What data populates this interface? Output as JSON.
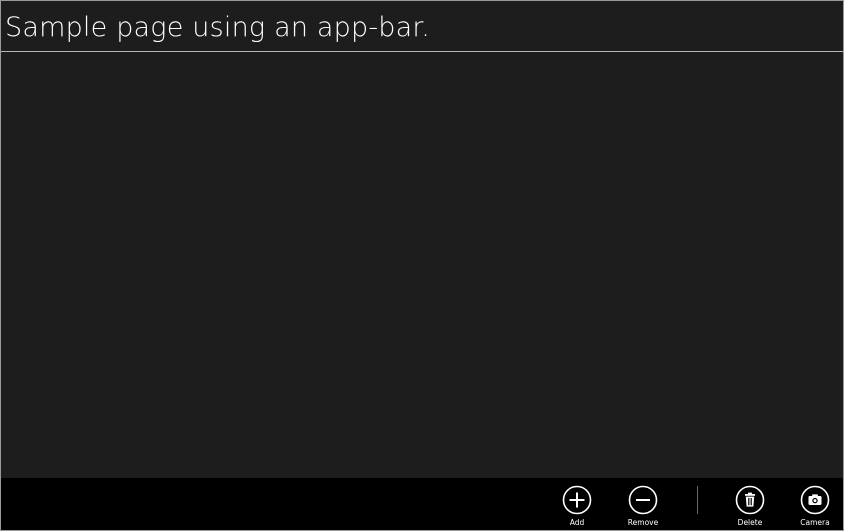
{
  "page": {
    "title": "Sample page using an app-bar."
  },
  "app_bar": {
    "primary_commands": [
      {
        "label": "Add",
        "icon": "add-icon"
      },
      {
        "label": "Remove",
        "icon": "remove-icon"
      }
    ],
    "secondary_commands": [
      {
        "label": "Delete",
        "icon": "delete-icon"
      },
      {
        "label": "Camera",
        "icon": "camera-icon"
      }
    ]
  },
  "colors": {
    "page_background": "#1d1d1d",
    "app_bar_background": "#000000",
    "foreground": "#ffffff",
    "title_rule": "#b9b9b9"
  }
}
